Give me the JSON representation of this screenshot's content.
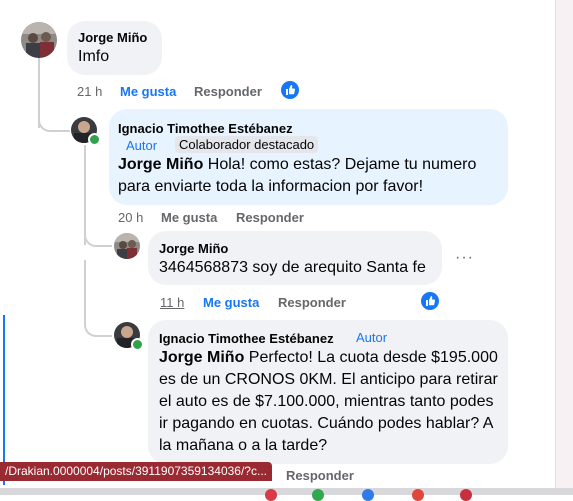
{
  "comments": [
    {
      "author": "Jorge Miño",
      "text": "Imfo",
      "time": "21 h",
      "like_label": "Me gusta",
      "reply_label": "Responder"
    },
    {
      "author": "Ignacio Timothee Estébanez",
      "role_label": "Autor",
      "badge_label": "Colaborador destacado",
      "mention": "Jorge Miño",
      "text": " Hola! como estas? Dejame tu numero para enviarte toda la informacion por favor!",
      "time": "20 h",
      "like_label": "Me gusta",
      "reply_label": "Responder"
    },
    {
      "author": "Jorge Miño",
      "text": "3464568873 soy de arequito Santa fe",
      "time": "11 h",
      "like_label": "Me gusta",
      "reply_label": "Responder",
      "more_label": "···"
    },
    {
      "author": "Ignacio Timothee Estébanez",
      "role_label": "Autor",
      "mention": "Jorge Miño",
      "text": " Perfecto! La cuota desde $195.000 es de un CRONOS 0KM. El anticipo para retirar el auto es de $7.100.000, mientras tanto podes ir pagando en cuotas. Cuándo podes hablar? A la mañana o a la tarde?",
      "reply_label": "Responder"
    }
  ],
  "status_url": "/Drakian.0000004/posts/3911907359134036/?c...",
  "icons": {
    "like": "thumbs-up-icon",
    "more": "more-options-icon"
  },
  "colors": {
    "facebook_blue": "#1877f2",
    "bubble": "#f0f2f5",
    "author_bubble": "#e7f3ff",
    "meta_gray": "#65676b",
    "status_bar": "#9a2a32"
  }
}
